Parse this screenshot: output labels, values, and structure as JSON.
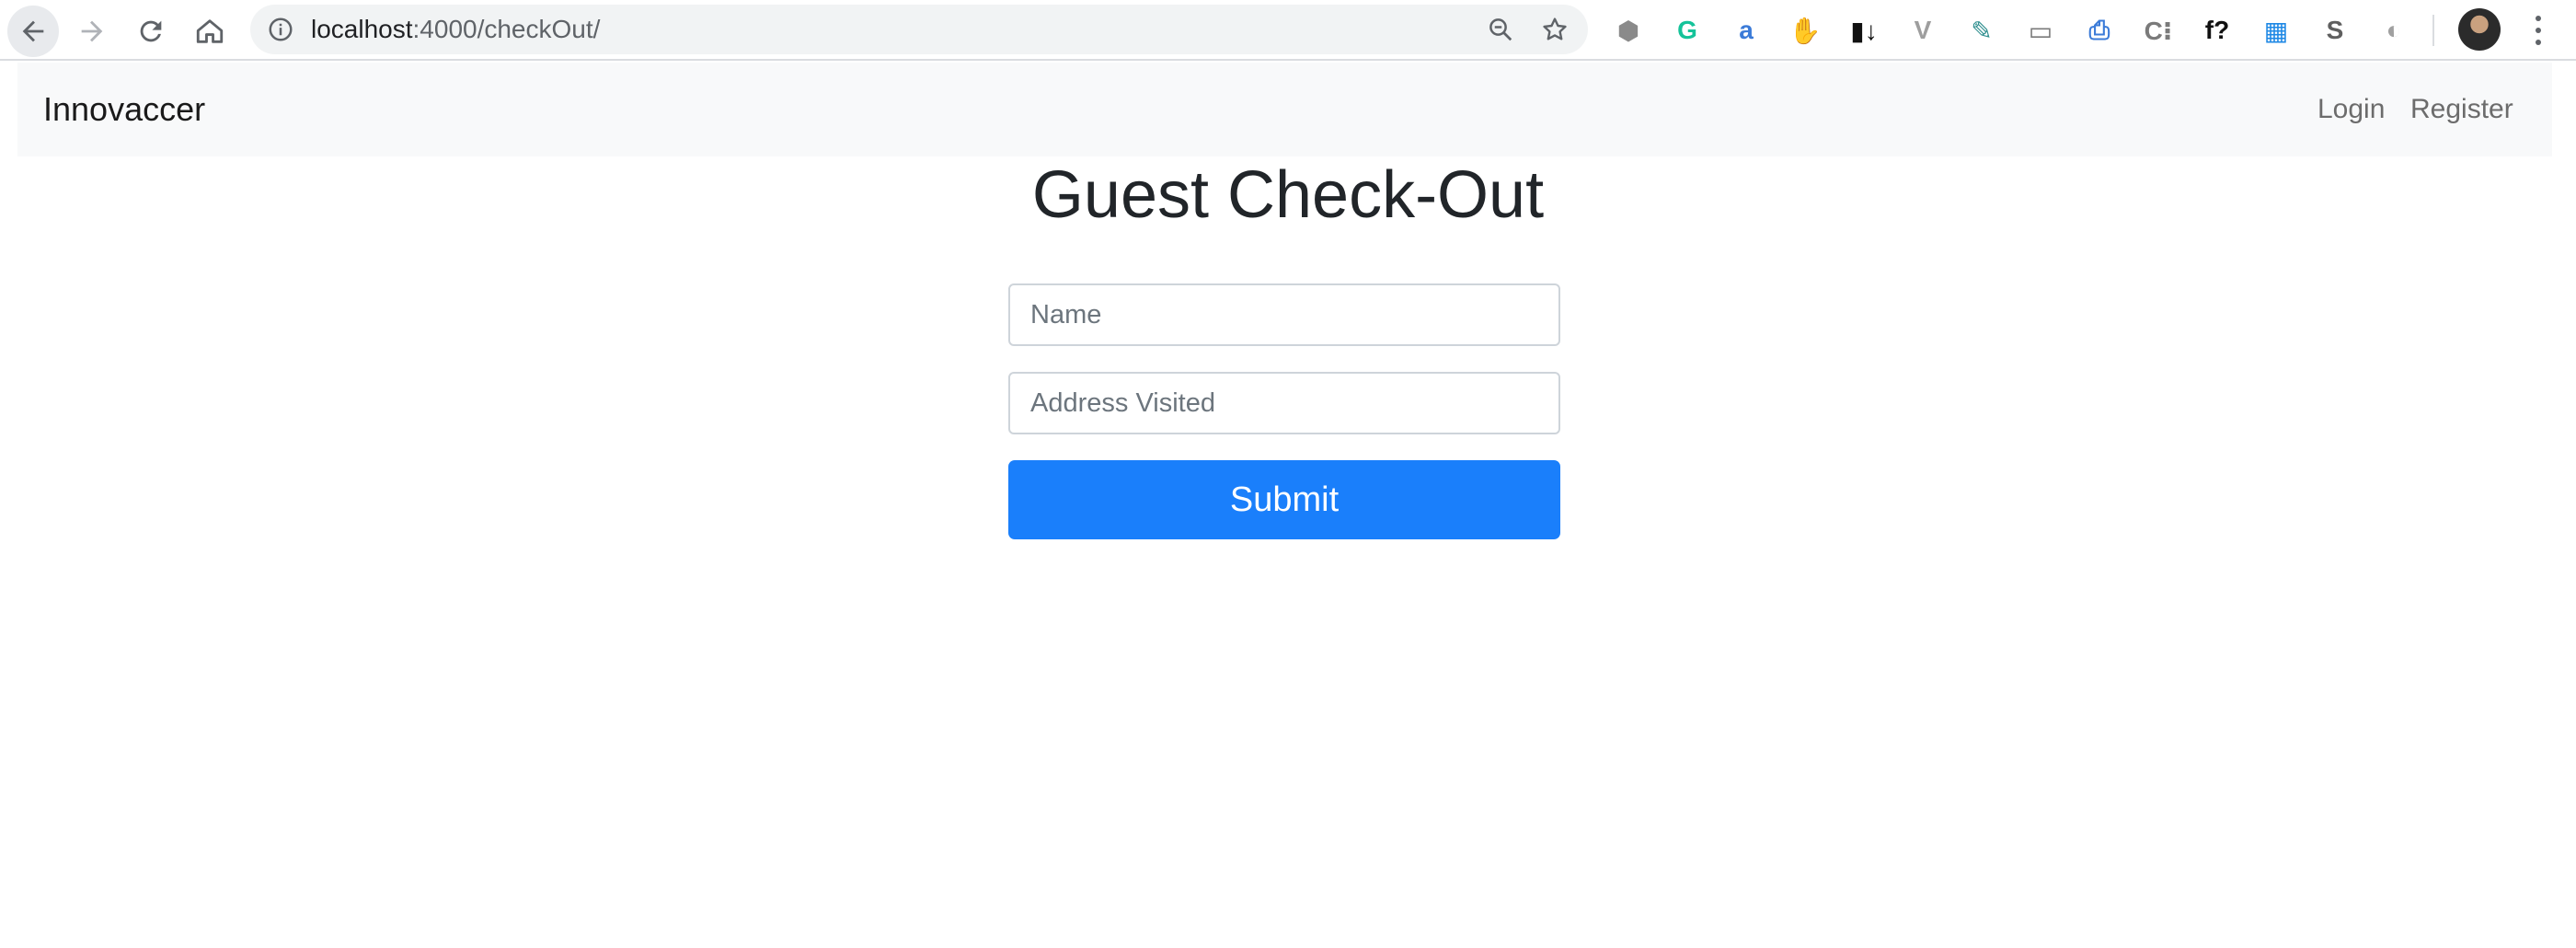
{
  "browser": {
    "url_host": "localhost",
    "url_rest": ":4000/checkOut/",
    "extensions": [
      {
        "name": "cube-extension-icon",
        "glyph": "⬢",
        "color": "#8a8a8a"
      },
      {
        "name": "grammarly-icon",
        "glyph": "G",
        "color": "#15c39a"
      },
      {
        "name": "a-extension-icon",
        "glyph": "a",
        "color": "#3b7bd8"
      },
      {
        "name": "stop-hand-icon",
        "glyph": "✋",
        "color": "#e02020"
      },
      {
        "name": "bars-arrow-icon",
        "glyph": "▮↓",
        "color": "#111111"
      },
      {
        "name": "vue-devtools-icon",
        "glyph": "V",
        "color": "#9e9e9e"
      },
      {
        "name": "eyedropper-icon",
        "glyph": "✎",
        "color": "#2f8f8f"
      },
      {
        "name": "cast-window-icon",
        "glyph": "▭",
        "color": "#7a7a7a"
      },
      {
        "name": "printer-extension-icon",
        "glyph": "⎙",
        "color": "#3b7bd8"
      },
      {
        "name": "c-extension-icon",
        "glyph": "C⁝",
        "color": "#7a7a7a"
      },
      {
        "name": "whatfont-icon",
        "glyph": "f?",
        "color": "#111111"
      },
      {
        "name": "window-layout-icon",
        "glyph": "▦",
        "color": "#1e88e5"
      },
      {
        "name": "s-extension-icon",
        "glyph": "S",
        "color": "#5f5f5f"
      },
      {
        "name": "circle-extension-icon",
        "glyph": "◐",
        "color": "#a0a0a0"
      }
    ]
  },
  "navbar": {
    "brand": "Innovaccer",
    "login": "Login",
    "register": "Register"
  },
  "form": {
    "title": "Guest Check-Out",
    "name_placeholder": "Name",
    "address_placeholder": "Address Visited",
    "submit_label": "Submit"
  },
  "colors": {
    "primary": "#1a7ffb",
    "navbar_bg": "#f8f9fa"
  }
}
